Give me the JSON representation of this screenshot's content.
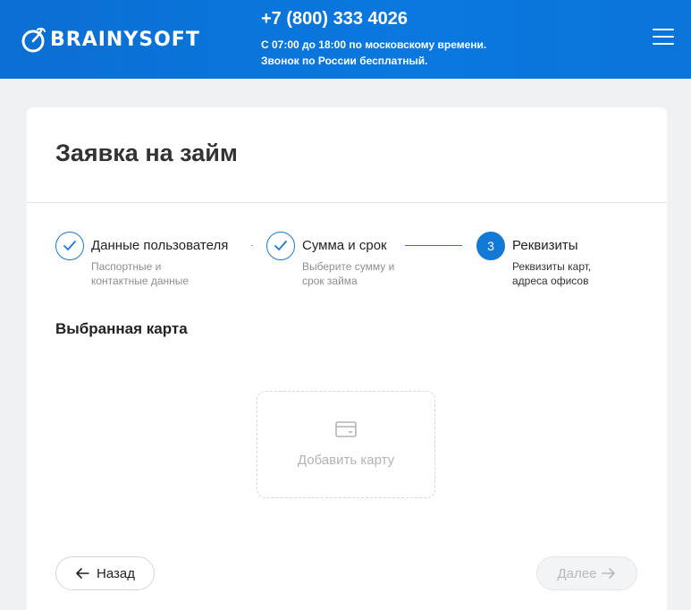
{
  "header": {
    "logo_text": "BRAINYSOFT",
    "phone": "+7 (800) 333 4026",
    "hours_line1": "С 07:00 до 18:00 по московскому времени.",
    "hours_line2": "Звонок по России бесплатный."
  },
  "page": {
    "title": "Заявка на займ"
  },
  "steps": [
    {
      "title": "Данные пользователя",
      "sub_line1": "Паспортные и",
      "sub_line2": "контактные данные",
      "state": "done"
    },
    {
      "title": "Сумма и срок",
      "sub_line1": "Выберите сумму и",
      "sub_line2": "срок займа",
      "state": "done"
    },
    {
      "number": "3",
      "title": "Реквизиты",
      "sub_line1": "Реквизиты карт,",
      "sub_line2": "адреса офисов",
      "state": "active"
    }
  ],
  "section": {
    "title": "Выбранная карта",
    "add_card_label": "Добавить карту"
  },
  "buttons": {
    "back_label": "Назад",
    "next_label": "Далее"
  },
  "colors": {
    "brand": "#0b74d9",
    "accent": "#1478d6",
    "muted": "#8a8f96"
  }
}
